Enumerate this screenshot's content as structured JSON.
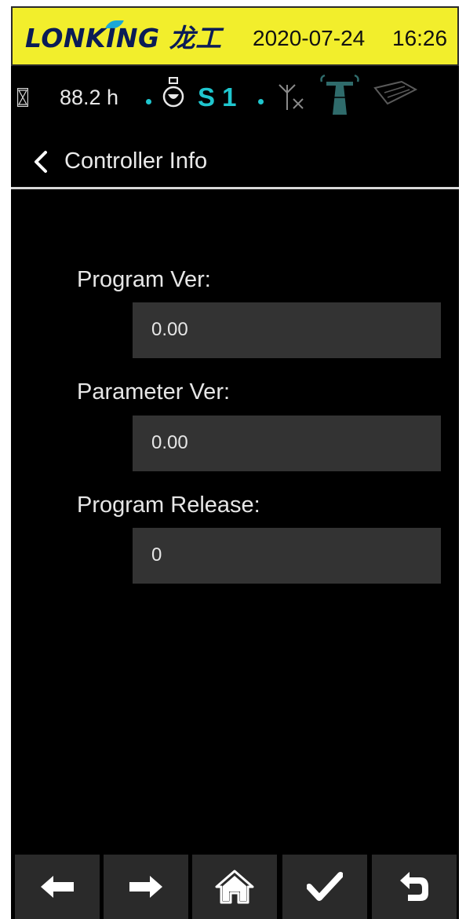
{
  "header": {
    "brand": "LONKING",
    "brand_cn": "龙工",
    "date": "2020-07-24",
    "time": "16:26",
    "bg_color": "#f2ee2c",
    "brand_color": "#0b1c56",
    "accent_color": "#1aa7d6"
  },
  "status": {
    "hours": "88.2 h",
    "gear": "S 1",
    "accent_color": "#1fc6ce",
    "icons": [
      "hourglass-icon",
      "engine-icon",
      "no-signal-antenna-icon",
      "signal-tower-icon",
      "card-icon"
    ]
  },
  "title": {
    "back_icon": "chevron-left-icon",
    "text": "Controller Info"
  },
  "fields": [
    {
      "label": "Program Ver:",
      "value": "0.00"
    },
    {
      "label": "Parameter Ver:",
      "value": "0.00"
    },
    {
      "label": "Program Release:",
      "value": "0"
    }
  ],
  "bottom_nav": [
    {
      "icon": "arrow-left-icon",
      "name": "nav-left-button"
    },
    {
      "icon": "arrow-right-icon",
      "name": "nav-right-button"
    },
    {
      "icon": "home-icon",
      "name": "nav-home-button"
    },
    {
      "icon": "checkmark-icon",
      "name": "nav-confirm-button"
    },
    {
      "icon": "return-icon",
      "name": "nav-return-button"
    }
  ]
}
